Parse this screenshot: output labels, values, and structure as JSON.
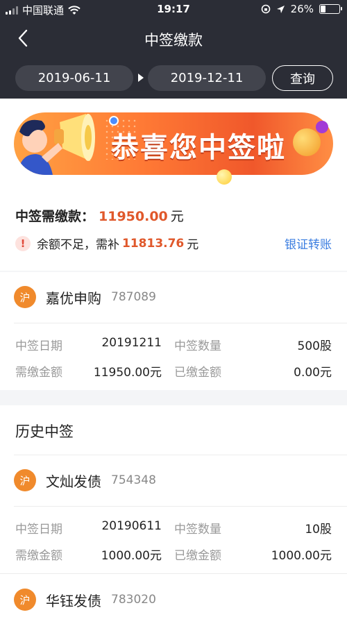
{
  "status": {
    "carrier": "中国联通",
    "time": "19:17",
    "battery": "26%",
    "battery_level": 0.26
  },
  "nav": {
    "title": "中签缴款"
  },
  "filter": {
    "start_date": "2019-06-11",
    "end_date": "2019-12-11",
    "query_label": "查询"
  },
  "banner": {
    "text": "恭喜您中签啦"
  },
  "summary": {
    "due_label": "中签需缴款：",
    "due_amount": "11950.00",
    "due_unit": "元",
    "warn_icon": "!",
    "warn_text": "余额不足，需补",
    "shortfall": "11813.76",
    "shortfall_unit": "元",
    "transfer_label": "银证转账"
  },
  "current": {
    "market": "沪",
    "name": "嘉优申购",
    "code": "787089",
    "date_label": "中签日期",
    "date": "20191211",
    "qty_label": "中签数量",
    "qty": "500股",
    "due_label": "需缴金额",
    "due": "11950.00元",
    "paid_label": "已缴金额",
    "paid": "0.00元"
  },
  "history": {
    "title": "历史中签",
    "items": [
      {
        "market": "沪",
        "name": "文灿发债",
        "code": "754348",
        "date_label": "中签日期",
        "date": "20190611",
        "qty_label": "中签数量",
        "qty": "10股",
        "due_label": "需缴金额",
        "due": "1000.00元",
        "paid_label": "已缴金额",
        "paid": "1000.00元"
      },
      {
        "market": "沪",
        "name": "华钰发债",
        "code": "783020"
      }
    ]
  },
  "colors": {
    "header_bg": "#2b2d36",
    "accent_orange": "#e0582b",
    "link_blue": "#3a7de0",
    "market_badge": "#f08a2c"
  }
}
